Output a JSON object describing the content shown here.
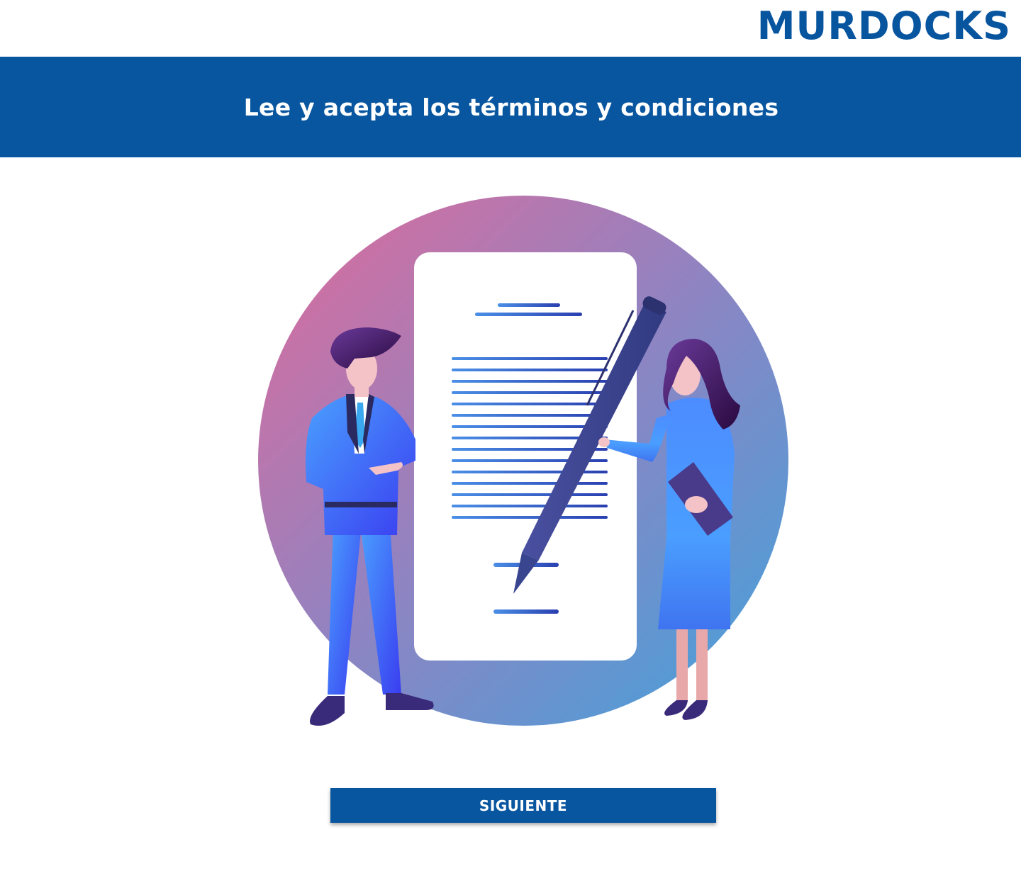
{
  "header": {
    "logo_text": "MURDOCKS"
  },
  "banner": {
    "title": "Lee y acepta los términos y condiciones"
  },
  "illustration": {
    "description_icon": "contract-signing-illustration-icon"
  },
  "actions": {
    "next_label": "SIGUIENTE"
  },
  "colors": {
    "brand": "#08569f",
    "background": "#ffffff",
    "button_text": "#ffffff"
  }
}
